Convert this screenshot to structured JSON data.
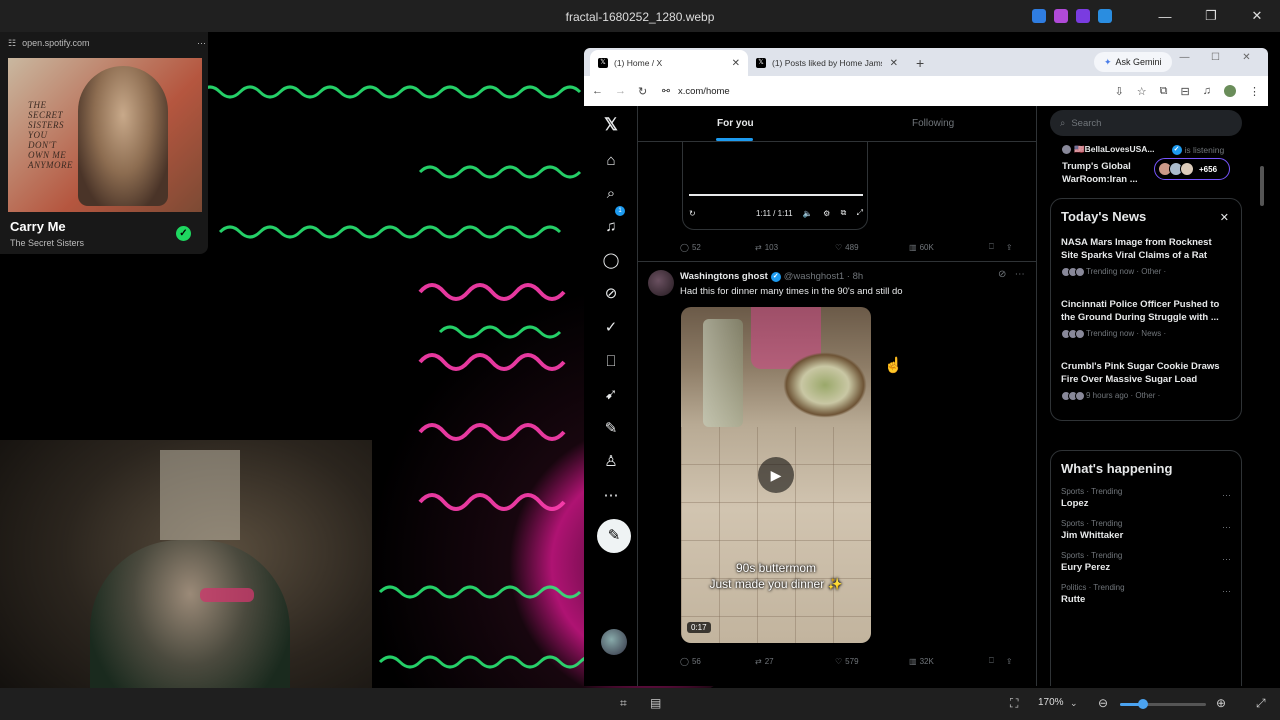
{
  "window": {
    "title": "fractal-1680252_1280.webp"
  },
  "spotify": {
    "url": "open.spotify.com",
    "cover_text": "THE SECRET SISTERS YOU DON'T OWN ME ANYMORE",
    "song": "Carry Me",
    "artist": "The Secret Sisters"
  },
  "browser": {
    "tabs": [
      {
        "title": "(1) Home / X"
      },
      {
        "title": "(1) Posts liked by Home Jams (@"
      }
    ],
    "ask_gemini": "Ask Gemini",
    "url": "x.com/home"
  },
  "x": {
    "feed_tabs": {
      "for_you": "For you",
      "following": "Following"
    },
    "notif_count": "1",
    "video1": {
      "time": "1:11 / 1:11"
    },
    "post1_actions": {
      "replies": "52",
      "reposts": "103",
      "likes": "489",
      "views": "60K"
    },
    "post2": {
      "name": "Washingtons ghost",
      "handle": "@washghost1 · 8h",
      "text": "Had this for dinner many times in the 90's and still do",
      "caption_line1": "90s buttermom",
      "caption_line2": "Just made you dinner ✨",
      "duration": "0:17",
      "replies": "56",
      "reposts": "27",
      "likes": "579",
      "views": "32K"
    },
    "search_placeholder": "Search",
    "space": {
      "host": "🇺🇸BellaLovesUSA...",
      "status": "is listening",
      "title1": "Trump's Global",
      "title2": "WarRoom:Iran ...",
      "count": "+656"
    },
    "todays_news": {
      "title": "Today's News",
      "items": [
        {
          "headline": "NASA Mars Image from Rocknest Site Sparks Viral Claims of a Rat",
          "meta": "Trending now · Other ·"
        },
        {
          "headline": "Cincinnati Police Officer Pushed to the Ground During Struggle with ...",
          "meta": "Trending now · News ·"
        },
        {
          "headline": "Crumbl's Pink Sugar Cookie Draws Fire Over Massive Sugar Load",
          "meta": "9 hours ago · Other ·"
        }
      ]
    },
    "whats_happening": {
      "title": "What's happening",
      "trends": [
        {
          "category": "Sports · Trending",
          "name": "Lopez"
        },
        {
          "category": "Sports · Trending",
          "name": "Jim Whittaker"
        },
        {
          "category": "Sports · Trending",
          "name": "Eury Perez"
        },
        {
          "category": "Politics · Trending",
          "name": "Rutte"
        }
      ]
    }
  },
  "viewer": {
    "zoom": "170%",
    "zoom_level": 0.24
  }
}
